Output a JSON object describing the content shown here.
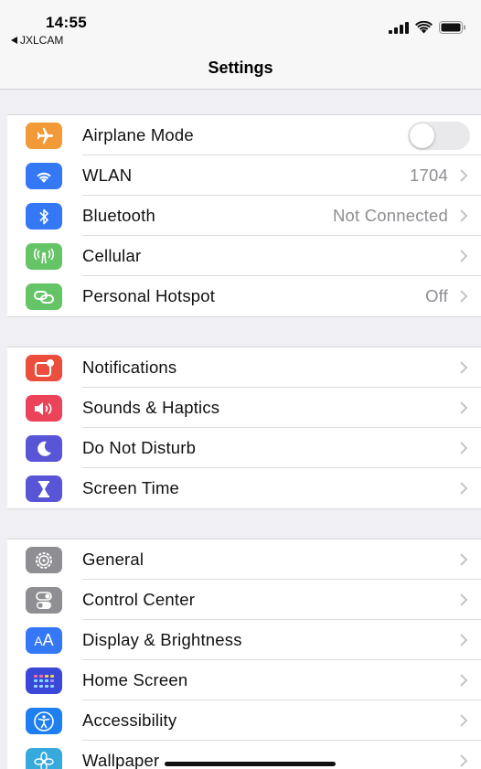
{
  "status_bar": {
    "time": "14:55",
    "back_app": "JXLCAM",
    "icons": [
      "signal-bars-icon",
      "wifi-icon",
      "battery-icon"
    ]
  },
  "nav": {
    "title": "Settings"
  },
  "groups": [
    {
      "rows": [
        {
          "label": "Airplane Mode",
          "icon": "airplane-icon",
          "color": "#f19a37",
          "toggle": false
        },
        {
          "label": "WLAN",
          "value": "1704",
          "icon": "wifi-icon",
          "color": "#3478f6"
        },
        {
          "label": "Bluetooth",
          "value": "Not Connected",
          "icon": "bluetooth-icon",
          "color": "#3478f6"
        },
        {
          "label": "Cellular",
          "value": "",
          "icon": "antenna-icon",
          "color": "#65c466"
        },
        {
          "label": "Personal Hotspot",
          "value": "Off",
          "icon": "hotspot-chain-icon",
          "color": "#65c466"
        }
      ]
    },
    {
      "rows": [
        {
          "label": "Notifications",
          "icon": "notifications-icon",
          "color": "#eb4e3d"
        },
        {
          "label": "Sounds & Haptics",
          "icon": "speaker-icon",
          "color": "#eb445a"
        },
        {
          "label": "Do Not Disturb",
          "icon": "moon-icon",
          "color": "#5856d6"
        },
        {
          "label": "Screen Time",
          "icon": "hourglass-icon",
          "color": "#5856d6"
        }
      ]
    },
    {
      "rows": [
        {
          "label": "General",
          "icon": "gear-icon",
          "color": "#8e8e93"
        },
        {
          "label": "Control Center",
          "icon": "toggles-icon",
          "color": "#8e8e93"
        },
        {
          "label": "Display & Brightness",
          "icon": "text-size-icon",
          "color": "#3478f6"
        },
        {
          "label": "Home Screen",
          "icon": "app-grid-icon",
          "color": "#3a48d8"
        },
        {
          "label": "Accessibility",
          "icon": "accessibility-icon",
          "color": "#1f7ff0"
        },
        {
          "label": "Wallpaper",
          "icon": "flower-icon",
          "color": "#36aadc"
        }
      ]
    }
  ]
}
